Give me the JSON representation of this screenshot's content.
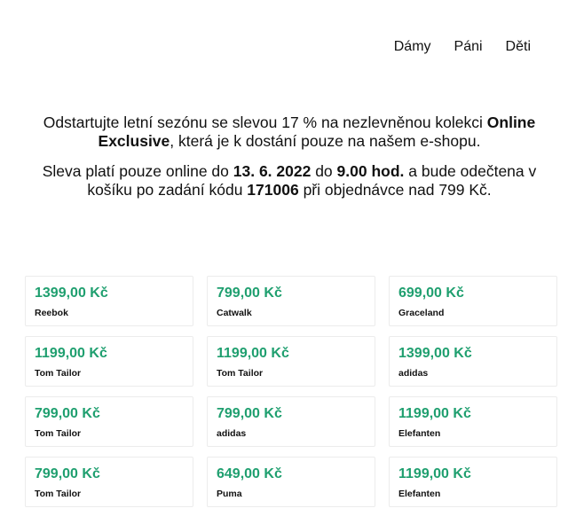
{
  "nav": {
    "items": [
      "Dámy",
      "Páni",
      "Děti"
    ]
  },
  "promo": {
    "p1_part1": "Odstartujte letní sezónu se slevou 17 % na nezlevněnou kolekci ",
    "p1_bold": "Online Exclusive",
    "p1_part2": ", která je k dostání pouze na našem e-shopu.",
    "p2_part1": "Sleva platí pouze online do ",
    "p2_date": "13. 6. 2022",
    "p2_part2": " do ",
    "p2_time": "9.00 hod.",
    "p2_part3": " a bude odečtena v košíku po zadání kódu ",
    "p2_code": "171006",
    "p2_part4": " při objednávce nad 799 Kč."
  },
  "products": [
    {
      "price": "1399,00 Kč",
      "brand": "Reebok"
    },
    {
      "price": "799,00 Kč",
      "brand": "Catwalk"
    },
    {
      "price": "699,00 Kč",
      "brand": "Graceland"
    },
    {
      "price": "1199,00 Kč",
      "brand": "Tom Tailor"
    },
    {
      "price": "1199,00 Kč",
      "brand": "Tom Tailor"
    },
    {
      "price": "1399,00 Kč",
      "brand": "adidas"
    },
    {
      "price": "799,00 Kč",
      "brand": "Tom Tailor"
    },
    {
      "price": "799,00 Kč",
      "brand": "adidas"
    },
    {
      "price": "1199,00 Kč",
      "brand": "Elefanten"
    },
    {
      "price": "799,00 Kč",
      "brand": "Tom Tailor"
    },
    {
      "price": "649,00 Kč",
      "brand": "Puma"
    },
    {
      "price": "1199,00 Kč",
      "brand": "Elefanten"
    }
  ],
  "colors": {
    "price": "#1f9f6f",
    "card_border": "#ececec"
  }
}
